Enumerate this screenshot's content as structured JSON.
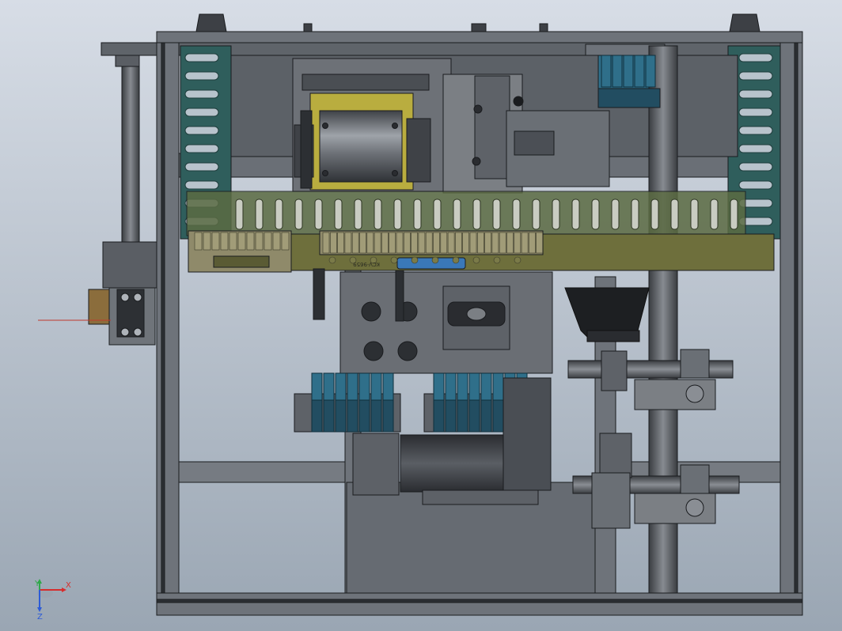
{
  "viewport": {
    "background_top": "#d7dde6",
    "background_bottom": "#9aa6b3"
  },
  "colors": {
    "frame": "#6e737a",
    "frame_dark": "#2c2f33",
    "frame_edge": "#1a1c1f",
    "plate": "#7b7f84",
    "cable_chain": "#2f5e5c",
    "cable_chain_dark": "#1e3c3b",
    "cable_tray": "#5b6b43",
    "din_rail": "#6e6f3c",
    "terminal": "#8f8a6a",
    "drum": "#b9ad3f",
    "drum_body": "#5e6166",
    "valve": "#2f6f8a",
    "valve_dark": "#224d61",
    "connector_blue": "#3a78b8",
    "hopper": "#1d1f22",
    "laser": "#c0392b",
    "triad_x": "#d62d2d",
    "triad_y": "#2fa84a",
    "triad_z": "#2d5bd6"
  },
  "annotations": {
    "rail_marking": "KCV-9659"
  },
  "triad": {
    "x_label": "X",
    "y_label": "Y",
    "z_label": "Z"
  }
}
